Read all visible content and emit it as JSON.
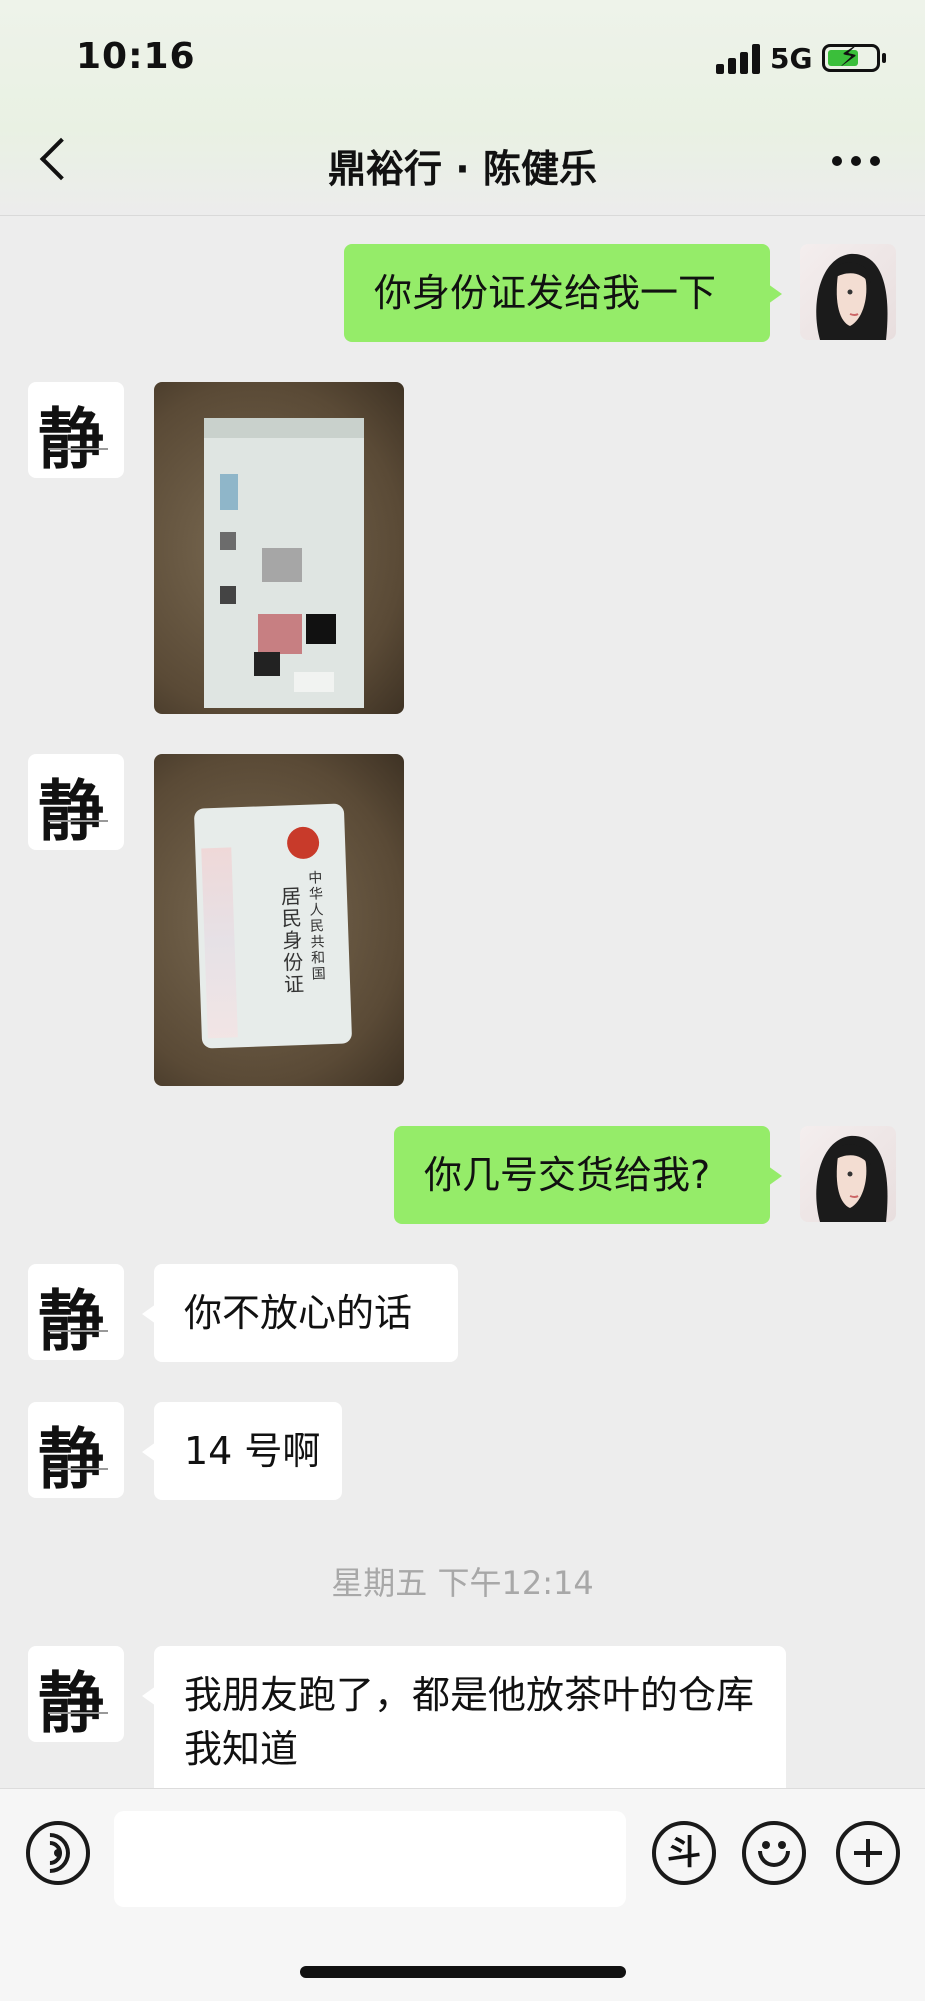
{
  "status_bar": {
    "time": "10:16",
    "network": "5G",
    "battery_charging": true
  },
  "nav": {
    "title": "鼎裕行 · 陈健乐"
  },
  "messages": [
    {
      "sender": "me",
      "type": "text",
      "text": "你身份证发给我一下"
    },
    {
      "sender": "them",
      "type": "image",
      "desc": "pixelated photo"
    },
    {
      "sender": "them",
      "type": "image",
      "desc": "ID card back photo"
    },
    {
      "sender": "me",
      "type": "text",
      "text": "你几号交货给我?"
    },
    {
      "sender": "them",
      "type": "text",
      "text": "你不放心的话"
    },
    {
      "sender": "them",
      "type": "text",
      "text": "14 号啊"
    },
    {
      "sender": "system",
      "type": "timestamp",
      "text": "星期五 下午12:14"
    },
    {
      "sender": "them",
      "type": "text",
      "text": "我朋友跑了，都是他放茶叶的仓库我知道"
    }
  ],
  "id_card": {
    "line1": "中华人民共和国",
    "line2": "居民身份证"
  },
  "avatar_char": "静",
  "input_bar": {
    "douyin_icon": "斗"
  },
  "colors": {
    "bubble_me": "#95ec69",
    "bubble_them": "#ffffff",
    "background": "#ededed"
  }
}
